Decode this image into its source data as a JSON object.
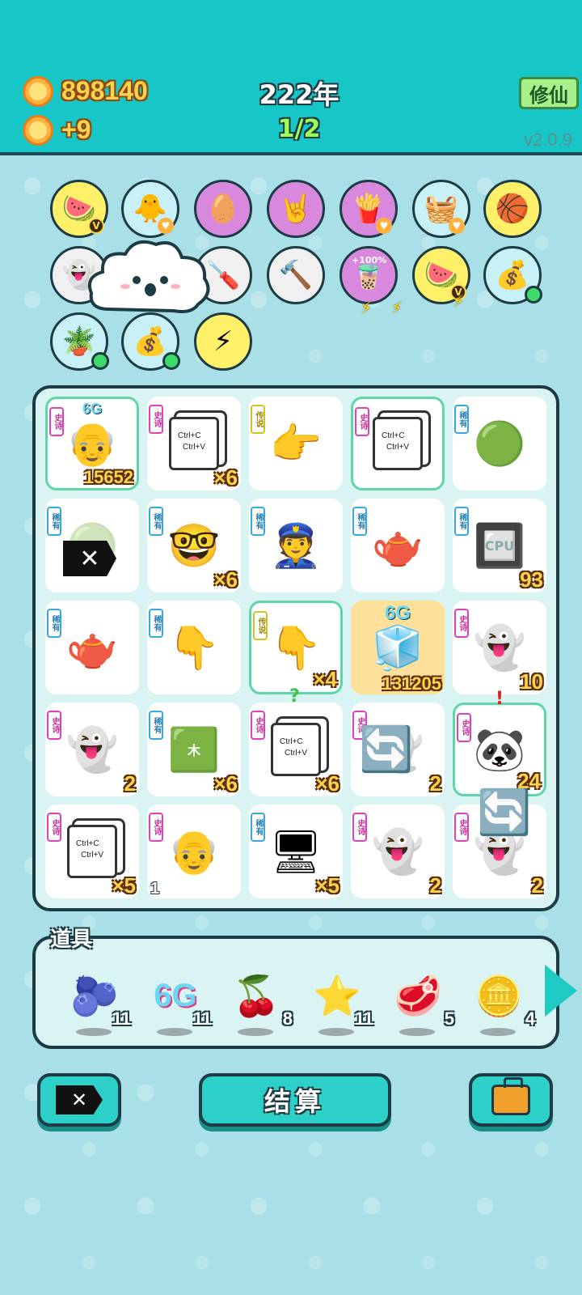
{
  "header": {
    "coins": "898140",
    "income": "+9",
    "year": "222年",
    "page": "1/2",
    "xiuxian_label": "修仙",
    "version": "v2.0.9"
  },
  "skills": [
    {
      "name": "fruit-basket",
      "icon": "🍉",
      "style": "yellow"
    },
    {
      "name": "chick-egg",
      "icon": "🐥",
      "style": "blue"
    },
    {
      "name": "egg-shell",
      "icon": "🥚",
      "style": "purple"
    },
    {
      "name": "rock-hand",
      "icon": "🤘",
      "style": "purple"
    },
    {
      "name": "fries",
      "icon": "🍟",
      "style": "purple"
    },
    {
      "name": "fruit-basket-2",
      "icon": "🧺",
      "style": "blue"
    },
    {
      "name": "basketballs",
      "icon": "🏀",
      "style": "yellow"
    },
    {
      "name": "ghost-tongue",
      "icon": "👻",
      "style": "gray"
    },
    {
      "name": "skip",
      "icon": "⏭",
      "style": "gray"
    },
    {
      "name": "screwdriver",
      "icon": "🪛",
      "style": "gray"
    },
    {
      "name": "hammer",
      "icon": "🔨",
      "style": "gray"
    },
    {
      "name": "bubble-tea",
      "icon": "🧋",
      "style": "purple"
    },
    {
      "name": "fruit-basket-3",
      "icon": "🍉",
      "style": "yellow"
    },
    {
      "name": "money-bag",
      "icon": "💰",
      "style": "blue"
    },
    {
      "name": "plant-pot",
      "icon": "🪴",
      "style": "blue"
    },
    {
      "name": "money-bag-2",
      "icon": "💰",
      "style": "blue"
    },
    {
      "name": "lightning",
      "icon": "⚡",
      "style": "yellow"
    }
  ],
  "skill_pct": "+100%",
  "tags": {
    "epic": "史诗",
    "rare": "稀有",
    "legend": "传说"
  },
  "copy_text": {
    "line1": "Ctrl+C",
    "line2": "Ctrl+V"
  },
  "board": [
    {
      "tag": "epic",
      "icon": "👴",
      "count": "15652",
      "top_label": "6G"
    },
    {
      "tag": "epic",
      "icon": "copy",
      "count": "×6"
    },
    {
      "tag": "legend",
      "icon": "👉",
      "count": ""
    },
    {
      "tag": "epic",
      "icon": "copy",
      "count": ""
    },
    {
      "tag": "rare",
      "icon": "🟢",
      "count": ""
    },
    {
      "tag": "rare",
      "icon": "x-box",
      "count": ""
    },
    {
      "tag": "rare",
      "icon": "🤓",
      "count": "×6"
    },
    {
      "tag": "rare",
      "icon": "👮",
      "count": ""
    },
    {
      "tag": "rare",
      "icon": "🫖",
      "count": ""
    },
    {
      "tag": "rare",
      "icon": "🔲",
      "count": "93",
      "inner": "CPU"
    },
    {
      "tag": "rare",
      "icon": "🫖",
      "count": ""
    },
    {
      "tag": "rare",
      "icon": "👇",
      "count": ""
    },
    {
      "tag": "legend",
      "icon": "👇",
      "count": "×4"
    },
    {
      "tag": "",
      "icon": "🧊",
      "count": "131205",
      "top_label": "6G"
    },
    {
      "tag": "epic",
      "icon": "👻",
      "count": "10"
    },
    {
      "tag": "epic",
      "icon": "👻",
      "count": "2"
    },
    {
      "tag": "rare",
      "icon": "🟩",
      "count": "×6",
      "inner": "木"
    },
    {
      "tag": "epic",
      "icon": "copy",
      "count": "×6",
      "mark": "?"
    },
    {
      "tag": "epic",
      "icon": "🔄",
      "count": "2"
    },
    {
      "tag": "epic",
      "icon": "🐼",
      "count": "24",
      "mark": "!"
    },
    {
      "tag": "epic",
      "icon": "copy",
      "count": "×5"
    },
    {
      "tag": "epic",
      "icon": "👴",
      "count": "1",
      "count_left": true
    },
    {
      "tag": "rare",
      "icon": "🖥",
      "count": "×5"
    },
    {
      "tag": "epic",
      "icon": "👻",
      "count": "2"
    },
    {
      "tag": "epic",
      "icon": "👻",
      "count": "2"
    }
  ],
  "props": {
    "title": "道具",
    "items": [
      {
        "name": "blueberry",
        "icon": "🫐",
        "count": "11"
      },
      {
        "name": "6g-signal",
        "icon": "6G",
        "count": "11"
      },
      {
        "name": "lychee",
        "icon": "🍒",
        "count": "8"
      },
      {
        "name": "star",
        "icon": "⭐",
        "count": "11"
      },
      {
        "name": "liver",
        "icon": "🥩",
        "count": "5"
      },
      {
        "name": "dollar-coin",
        "icon": "🪙",
        "count": "4"
      }
    ]
  },
  "buttons": {
    "settle_label": "结算"
  }
}
